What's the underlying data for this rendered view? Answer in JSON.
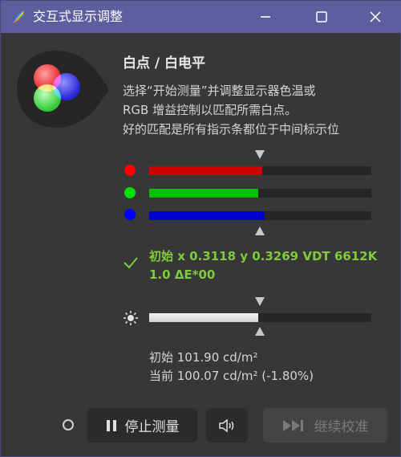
{
  "window": {
    "title": "交互式显示调整",
    "app_icon": "rainbow-feather-icon",
    "controls": [
      "minimize-icon",
      "maximize-icon",
      "close-icon"
    ]
  },
  "content": {
    "icon": "rgb-circles-icon",
    "heading": "白点 / 白电平",
    "description": [
      "选择“开始测量”并调整显示器色温或",
      "RGB 增益控制以匹配所需白点。",
      "好的匹配是所有指示条都位于中间标示位"
    ]
  },
  "rgb_bars": [
    {
      "channel": "red",
      "color": "#ff0000",
      "fill_color": "#d00000",
      "level": 0.51
    },
    {
      "channel": "green",
      "color": "#00e000",
      "fill_color": "#00c000",
      "level": 0.49
    },
    {
      "channel": "blue",
      "color": "#0000ff",
      "fill_color": "#0000d0",
      "level": 0.52
    }
  ],
  "result": {
    "status_icon": "checkmark-icon",
    "status_color": "#7ecb3c",
    "line1": "初始 x 0.3118 y 0.3269 VDT 6612K",
    "line2": "1.0 ΔE*00"
  },
  "luminance": {
    "icon": "sun-icon",
    "level": 0.49,
    "initial": "初始 101.90 cd/m²",
    "current": "当前 100.07 cd/m² (-1.80%)"
  },
  "footer": {
    "stop_label": "停止测量",
    "stop_icon": "pause-icon",
    "sound_icon": "speaker-icon",
    "continue_label": "继续校准",
    "continue_icon": "skip-forward-icon"
  }
}
